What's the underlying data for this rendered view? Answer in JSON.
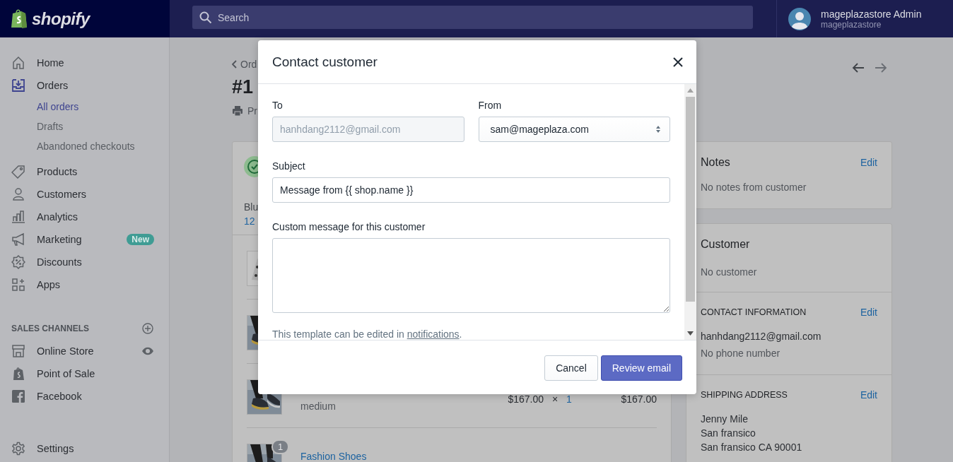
{
  "topbar": {
    "logo": "shopify",
    "search": {
      "placeholder": "Search"
    },
    "account": {
      "name": "mageplazastore Admin",
      "store": "mageplazastore"
    }
  },
  "sidebar": {
    "items": [
      {
        "label": "Home",
        "kind": "home",
        "selected": false
      },
      {
        "label": "Orders",
        "kind": "orders",
        "selected": true,
        "children": [
          {
            "label": "All orders",
            "selected": true
          },
          {
            "label": "Drafts",
            "selected": false
          },
          {
            "label": "Abandoned checkouts",
            "selected": false
          }
        ]
      },
      {
        "label": "Products",
        "kind": "products",
        "selected": false
      },
      {
        "label": "Customers",
        "kind": "customers",
        "selected": false
      },
      {
        "label": "Analytics",
        "kind": "analytics",
        "selected": false
      },
      {
        "label": "Marketing",
        "kind": "marketing",
        "selected": false,
        "badge": "New"
      },
      {
        "label": "Discounts",
        "kind": "discounts",
        "selected": false
      },
      {
        "label": "Apps",
        "kind": "apps",
        "selected": false
      }
    ],
    "section": {
      "title": "SALES CHANNELS",
      "channels": [
        {
          "label": "Online Store",
          "kind": "store",
          "selected": false
        },
        {
          "label": "Point of Sale",
          "kind": "pos",
          "selected": false
        },
        {
          "label": "Facebook",
          "kind": "facebook",
          "selected": false
        }
      ]
    },
    "settings": {
      "label": "Settings",
      "kind": "settings",
      "selected": false
    }
  },
  "page": {
    "breadcrumb": "Ord",
    "title": "#1",
    "action": "Pr",
    "fulfillment": {
      "line_1": "Blu",
      "line_2": "12"
    },
    "line_items": [
      {
        "kind": "pattern"
      },
      {
        "kind": "shoe"
      },
      {
        "kind": "shoe",
        "variant": "medium",
        "price": "$167.00",
        "times": "×",
        "qty": "1",
        "total": "$167.00"
      },
      {
        "kind": "shoe",
        "badge": "1",
        "name": "Fashion Shoes"
      }
    ],
    "notes": {
      "title": "Notes",
      "edit": "Edit",
      "text": "No notes from customer"
    },
    "customer": {
      "title": "Customer",
      "text": "No customer",
      "contact": {
        "title": "CONTACT INFORMATION",
        "edit": "Edit",
        "email": "hanhdang2112@gmail.com",
        "phone": "No phone number"
      },
      "shipping": {
        "title": "SHIPPING ADDRESS",
        "edit": "Edit",
        "lines": [
          "Jenny Mile",
          "San fransico",
          "San fransico CA 90001"
        ]
      }
    }
  },
  "modal": {
    "title": "Contact customer",
    "to": {
      "label": "To",
      "value": "hanhdang2112@gmail.com",
      "disabled": true
    },
    "from": {
      "label": "From",
      "value": "sam@mageplaza.com"
    },
    "subject": {
      "label": "Subject",
      "value": "Message from {{ shop.name }}"
    },
    "message": {
      "label": "Custom message for this customer"
    },
    "help": {
      "text": "This template can be edited in ",
      "link": "notifications",
      "after": "."
    },
    "buttons": [
      {
        "label": "Cancel",
        "kind": "secondary"
      },
      {
        "label": "Review email",
        "kind": "primary"
      }
    ]
  }
}
